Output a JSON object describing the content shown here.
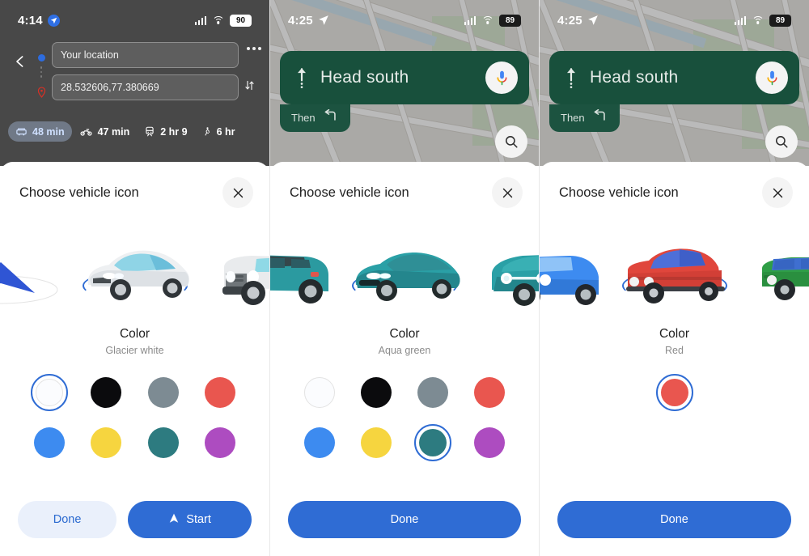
{
  "meta": {
    "accent_blue": "#2f6cd4",
    "sheet_bg": "#ffffff",
    "nav_green": "#18503c"
  },
  "panels": [
    {
      "id": "panel-1",
      "status_bar": {
        "time": "4:14",
        "location_icon": "location-arrow-icon",
        "signal_icon": "cellular-signal-icon",
        "wifi_icon": "wifi-icon",
        "battery_level": "90"
      },
      "backdrop_type": "directions",
      "directions": {
        "back_icon": "back-chevron-icon",
        "origin_icon": "origin-dot-icon",
        "destination_icon": "destination-pin-icon",
        "origin_value": "Your location",
        "destination_value": "28.532606,77.380669",
        "more_icon": "more-horizontal-icon",
        "swap_icon": "swap-vertical-icon",
        "modes": [
          {
            "icon": "car-icon",
            "label": "48 min",
            "selected": true
          },
          {
            "icon": "motorcycle-icon",
            "label": "47 min",
            "selected": false
          },
          {
            "icon": "transit-icon",
            "label": "2 hr 9",
            "selected": false
          },
          {
            "icon": "walk-icon",
            "label": "6 hr",
            "selected": false
          }
        ]
      },
      "sheet": {
        "title": "Choose vehicle icon",
        "close_icon": "close-icon",
        "vehicles": [
          {
            "name": "navigation-arrow-chevron",
            "selected": false,
            "kind": "arrow",
            "body": "#2f55d4",
            "glass": "#ffffff"
          },
          {
            "name": "sports-sedan",
            "selected": true,
            "kind": "sedan",
            "body": "#e9ecef",
            "glass": "#9fd8e8"
          },
          {
            "name": "off-road-suv",
            "selected": false,
            "kind": "suv",
            "body": "#e6e8ea",
            "glass": "#a8dfe9"
          }
        ],
        "color": {
          "heading": "Color",
          "selected_name": "Glacier white",
          "swatches": [
            {
              "name": "glacier-white",
              "hex": "#fbfcfe",
              "selected": true
            },
            {
              "name": "black",
              "hex": "#0b0b0d",
              "selected": false
            },
            {
              "name": "grey",
              "hex": "#7d8b93",
              "selected": false
            },
            {
              "name": "red",
              "hex": "#e9564f",
              "selected": false
            },
            {
              "name": "blue",
              "hex": "#3d8bf0",
              "selected": false
            },
            {
              "name": "yellow",
              "hex": "#f6d53f",
              "selected": false
            },
            {
              "name": "aqua-green",
              "hex": "#2d7b80",
              "selected": false
            },
            {
              "name": "purple",
              "hex": "#ad4cc0",
              "selected": false
            }
          ]
        },
        "buttons": [
          {
            "name": "done-button",
            "label": "Done",
            "style": "secondary",
            "icon": null
          },
          {
            "name": "start-button",
            "label": "Start",
            "style": "primary",
            "icon": "navigation-arrow-icon"
          }
        ]
      }
    },
    {
      "id": "panel-2",
      "status_bar": {
        "time": "4:25",
        "location_icon": "location-arrow-icon",
        "signal_icon": "cellular-signal-icon",
        "wifi_icon": "wifi-icon",
        "battery_level": "89"
      },
      "backdrop_type": "navigation",
      "navigation": {
        "maneuver_icon": "straight-arrow-icon",
        "instruction": "Head south",
        "mic_icon": "google-assistant-mic-icon",
        "then_label": "Then",
        "then_icon": "turn-left-arrow-icon",
        "search_icon": "search-icon"
      },
      "sheet": {
        "title": "Choose vehicle icon",
        "close_icon": "close-icon",
        "vehicles": [
          {
            "name": "classic-suv",
            "selected": false,
            "kind": "suv",
            "body": "#2b9aa0",
            "glass": "#3d4a4d"
          },
          {
            "name": "sports-sedan",
            "selected": true,
            "kind": "sedan",
            "body": "#2aa0a6",
            "glass": "#2f8f96"
          },
          {
            "name": "compact-hatchback",
            "selected": false,
            "kind": "hatch",
            "body": "#2aa0a6",
            "glass": "#39b0b4"
          }
        ],
        "color": {
          "heading": "Color",
          "selected_name": "Aqua green",
          "swatches": [
            {
              "name": "glacier-white",
              "hex": "#fbfcfe",
              "selected": false
            },
            {
              "name": "black",
              "hex": "#0b0b0d",
              "selected": false
            },
            {
              "name": "grey",
              "hex": "#7d8b93",
              "selected": false
            },
            {
              "name": "red",
              "hex": "#e9564f",
              "selected": false
            },
            {
              "name": "blue",
              "hex": "#3d8bf0",
              "selected": false
            },
            {
              "name": "yellow",
              "hex": "#f6d53f",
              "selected": false
            },
            {
              "name": "aqua-green",
              "hex": "#2d7b80",
              "selected": true
            },
            {
              "name": "purple",
              "hex": "#ad4cc0",
              "selected": false
            }
          ]
        },
        "buttons": [
          {
            "name": "done-button",
            "label": "Done",
            "style": "primary-full",
            "icon": null
          }
        ]
      }
    },
    {
      "id": "panel-3",
      "status_bar": {
        "time": "4:25",
        "location_icon": "location-arrow-icon",
        "signal_icon": "cellular-signal-icon",
        "wifi_icon": "wifi-icon",
        "battery_level": "89"
      },
      "backdrop_type": "navigation",
      "navigation": {
        "maneuver_icon": "straight-arrow-icon",
        "instruction": "Head south",
        "mic_icon": "google-assistant-mic-icon",
        "then_label": "Then",
        "then_icon": "turn-left-arrow-icon",
        "search_icon": "search-icon"
      },
      "sheet": {
        "title": "Choose vehicle icon",
        "close_icon": "close-icon",
        "vehicles": [
          {
            "name": "compact-hatchback",
            "selected": false,
            "kind": "hatch",
            "body": "#3d8bf0",
            "glass": "#8fc3f7"
          },
          {
            "name": "retro-sedan",
            "selected": true,
            "kind": "retro",
            "body": "#e0463c",
            "glass": "#4e6fd8"
          },
          {
            "name": "pickup-truck",
            "selected": false,
            "kind": "pickup",
            "body": "#2f9e46",
            "glass": "#3f6fd0"
          }
        ],
        "color": {
          "heading": "Color",
          "selected_name": "Red",
          "swatches": [
            {
              "name": "red",
              "hex": "#e9564f",
              "selected": true
            }
          ]
        },
        "buttons": [
          {
            "name": "done-button",
            "label": "Done",
            "style": "primary-full",
            "icon": null
          }
        ]
      }
    }
  ]
}
